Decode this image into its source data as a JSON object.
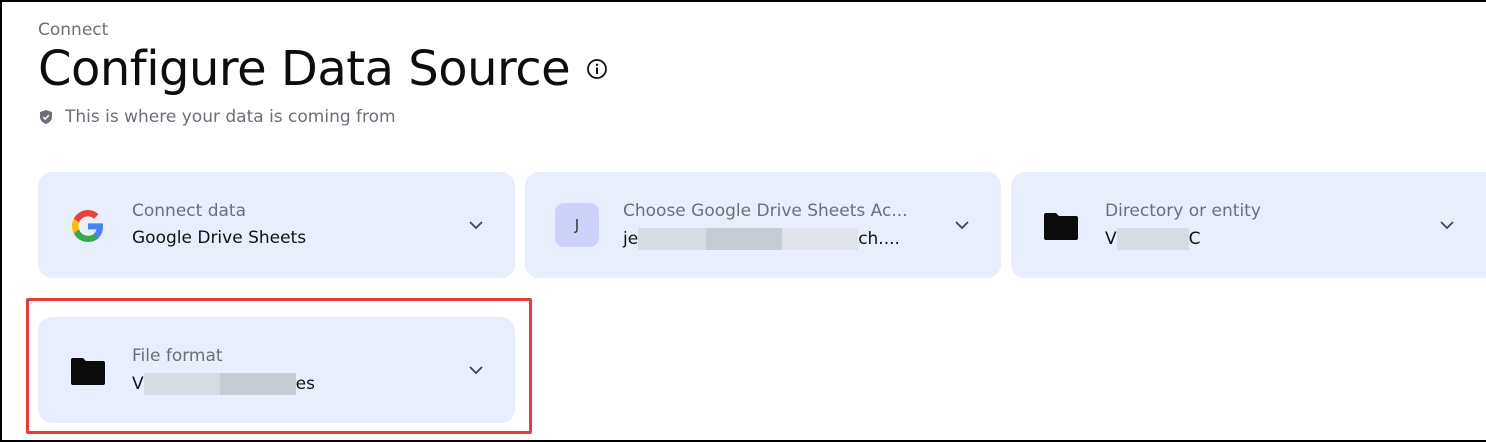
{
  "header": {
    "breadcrumb": "Connect",
    "title": "Configure Data Source",
    "subtitle": "This is where your data is coming from"
  },
  "cards": [
    {
      "label": "Connect data",
      "value": "Google Drive Sheets",
      "icon": "google-icon"
    },
    {
      "label": "Choose Google Drive Sheets Ac...",
      "value_prefix": "je",
      "value_suffix": "ch....",
      "avatar_letter": "J",
      "icon": "avatar"
    },
    {
      "label": "Directory or entity",
      "value_prefix": "V",
      "value_suffix": "C",
      "icon": "folder-icon"
    },
    {
      "label": "File format",
      "value_prefix": "V",
      "value_suffix": "es",
      "icon": "folder-icon"
    }
  ],
  "colors": {
    "card_bg": "#e9eefc",
    "highlight": "#e63c3c",
    "avatar_bg": "#cdd2fb"
  }
}
